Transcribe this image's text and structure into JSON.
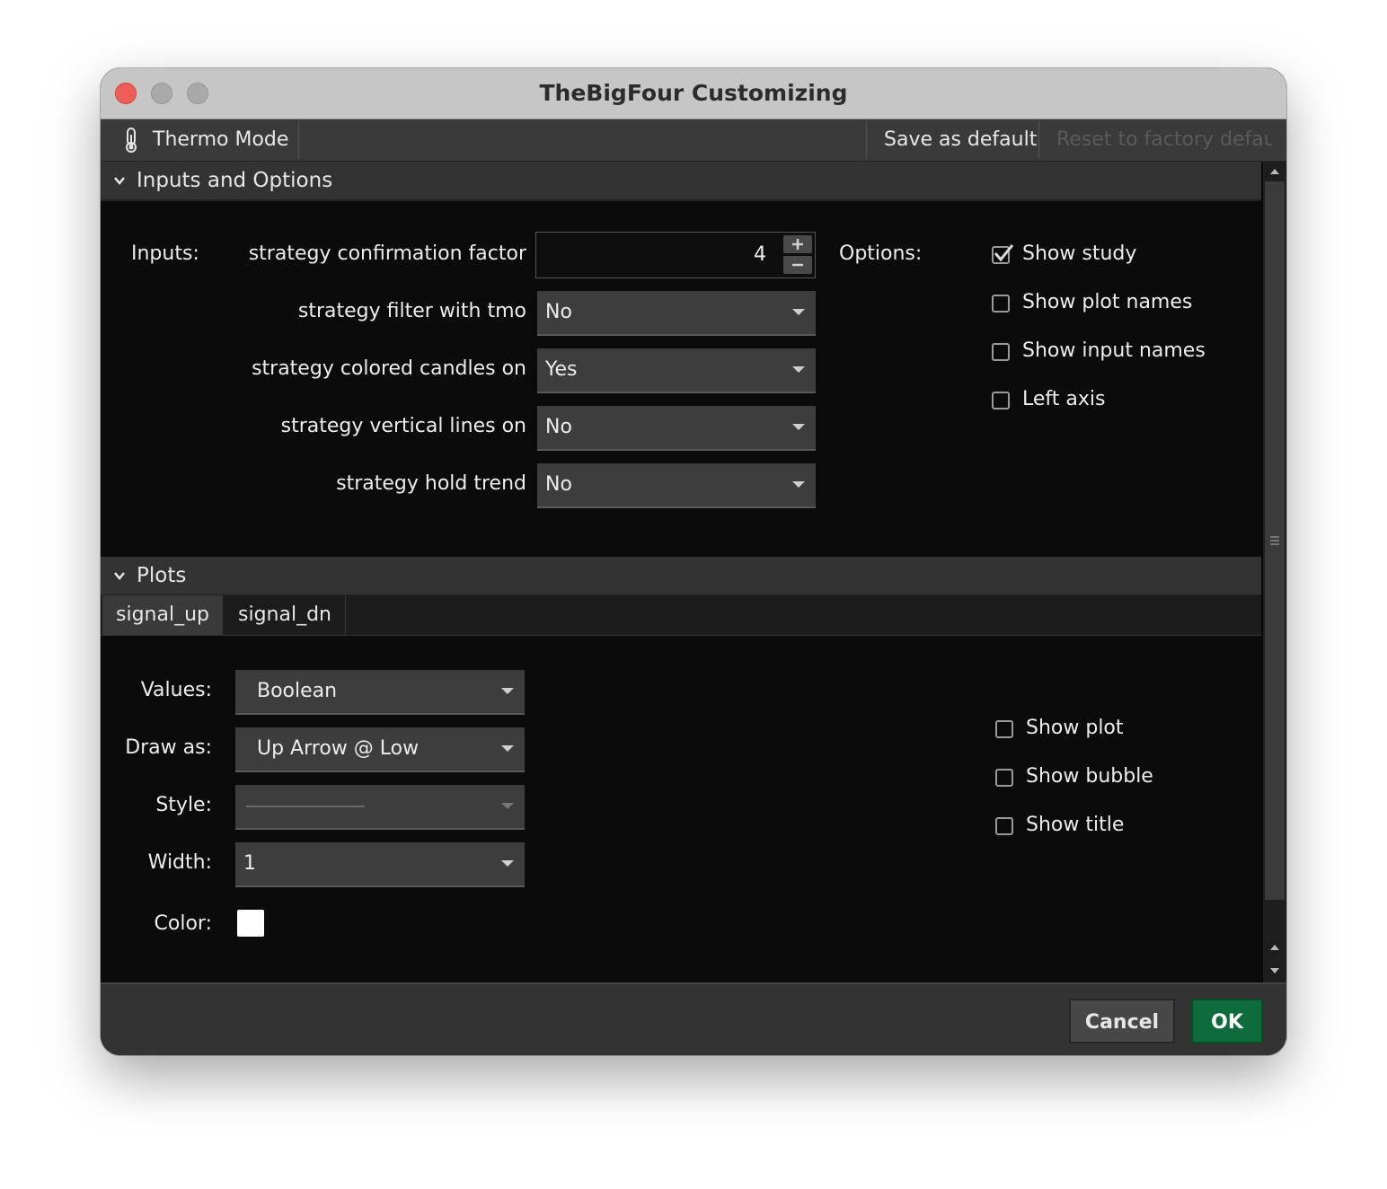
{
  "window": {
    "title": "TheBigFour Customizing"
  },
  "toolbar": {
    "thermo_label": "Thermo Mode",
    "save_default": "Save as default",
    "reset_default": "Reset to factory default"
  },
  "inputs_section": {
    "header": "Inputs and Options",
    "inputs_label": "Inputs:",
    "options_label": "Options:",
    "fields": [
      {
        "label": "strategy confirmation factor",
        "value": "4"
      },
      {
        "label": "strategy filter with tmo",
        "value": "No"
      },
      {
        "label": "strategy colored candles on",
        "value": "Yes"
      },
      {
        "label": "strategy vertical lines on",
        "value": "No"
      },
      {
        "label": "strategy hold trend",
        "value": "No"
      }
    ],
    "options": [
      {
        "label": "Show study",
        "checked": true
      },
      {
        "label": "Show plot names",
        "checked": false
      },
      {
        "label": "Show input names",
        "checked": false
      },
      {
        "label": "Left axis",
        "checked": false
      }
    ]
  },
  "plots_section": {
    "header": "Plots",
    "tabs": [
      "signal_up",
      "signal_dn"
    ],
    "active_tab": "signal_up",
    "values_label": "Values:",
    "values_value": "Boolean",
    "draw_as_label": "Draw as:",
    "draw_as_value": "Up Arrow @ Low",
    "style_label": "Style:",
    "width_label": "Width:",
    "width_value": "1",
    "color_label": "Color:",
    "color_value": "#ffffff",
    "options": [
      {
        "label": "Show plot",
        "checked": false
      },
      {
        "label": "Show bubble",
        "checked": false
      },
      {
        "label": "Show title",
        "checked": false
      }
    ]
  },
  "footer": {
    "cancel": "Cancel",
    "ok": "OK"
  },
  "colors": {
    "ok_button": "#0d6b3c",
    "close_button": "#ee5e56"
  }
}
